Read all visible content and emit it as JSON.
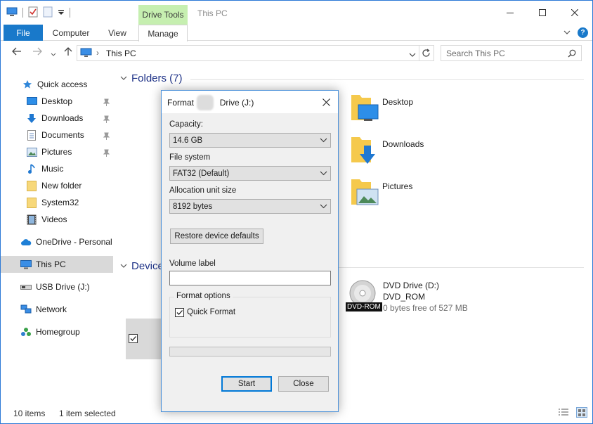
{
  "window": {
    "title": "This PC",
    "contextual_tab_label": "Drive Tools",
    "controls": {
      "minimize": "—",
      "maximize": "☐",
      "close": "✕"
    }
  },
  "ribbon": {
    "tabs": [
      {
        "label": "File"
      },
      {
        "label": "Computer"
      },
      {
        "label": "View"
      },
      {
        "label": "Manage"
      }
    ]
  },
  "address": {
    "path_label": "This PC",
    "separator": "›",
    "search_placeholder": "Search This PC"
  },
  "nav": {
    "quick_access": "Quick access",
    "items": [
      {
        "label": "Desktop",
        "pinned": true
      },
      {
        "label": "Downloads",
        "pinned": true
      },
      {
        "label": "Documents",
        "pinned": true
      },
      {
        "label": "Pictures",
        "pinned": true
      },
      {
        "label": "Music",
        "pinned": false
      },
      {
        "label": "New folder",
        "pinned": false
      },
      {
        "label": "System32",
        "pinned": false
      },
      {
        "label": "Videos",
        "pinned": false
      }
    ],
    "onedrive": "OneDrive - Personal",
    "this_pc": "This PC",
    "usb": "USB Drive (J:)",
    "network": "Network",
    "homegroup": "Homegroup"
  },
  "content": {
    "folders_header": "Folders (7)",
    "devices_header": "Device",
    "folders": [
      {
        "label": "Desktop"
      },
      {
        "label": "Downloads"
      },
      {
        "label": "Pictures"
      }
    ],
    "dvd": {
      "name": "DVD Drive (D:)",
      "label": "DVD_ROM",
      "space": "0 bytes free of 527 MB",
      "badge": "DVD-ROM"
    }
  },
  "status": {
    "items": "10 items",
    "selected": "1 item selected"
  },
  "dialog": {
    "title_prefix": "Format",
    "title_suffix": "Drive (J:)",
    "capacity_label": "Capacity:",
    "capacity_value": "14.6 GB",
    "fs_label": "File system",
    "fs_value": "FAT32 (Default)",
    "alloc_label": "Allocation unit size",
    "alloc_value": "8192 bytes",
    "restore_button": "Restore device defaults",
    "volume_label": "Volume label",
    "volume_value": "",
    "format_options_label": "Format options",
    "quick_format_label": "Quick Format",
    "quick_format_checked": true,
    "progress": 0,
    "start_button": "Start",
    "close_button": "Close"
  },
  "colors": {
    "accent": "#1979ca",
    "contextual_tab": "#c6efb0",
    "group_header": "#1e3287",
    "folder_yellow": "#f5c94c"
  }
}
